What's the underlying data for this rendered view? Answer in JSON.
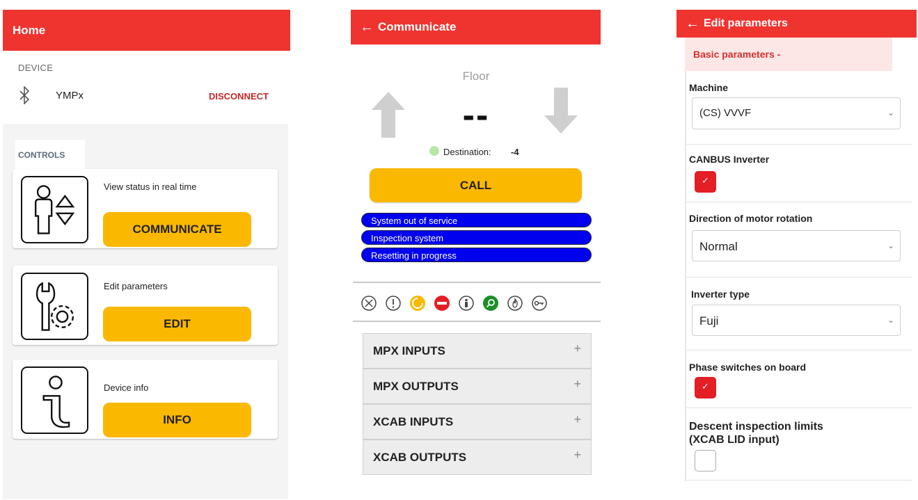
{
  "home": {
    "title": "Home",
    "device_label": "DEVICE",
    "device_name": "YMPx",
    "disconnect_label": "DISCONNECT",
    "controls_label": "CONTROLS",
    "cards": [
      {
        "text": "View status in real time",
        "button": "COMMUNICATE"
      },
      {
        "text": "Edit parameters",
        "button": "EDIT"
      },
      {
        "text": "Device info",
        "button": "INFO"
      }
    ]
  },
  "communicate": {
    "title": "Communicate",
    "floor_label": "Floor",
    "floor_value": "--",
    "destination_label": "Destination:",
    "destination_value": "-4",
    "call_label": "CALL",
    "statuses": [
      "System out of service",
      "Inspection system",
      "Resetting in progress"
    ],
    "accordions": [
      "MPX INPUTS",
      "MPX OUTPUTS",
      "XCAB INPUTS",
      "XCAB OUTPUTS"
    ],
    "plus": "+"
  },
  "edit": {
    "title": "Edit parameters",
    "section": "Basic parameters -",
    "machine_label": "Machine",
    "machine_value": "(CS) VVVF",
    "canbus_label": "CANBUS Inverter",
    "canbus_checked": true,
    "direction_label": "Direction of motor rotation",
    "direction_value": "Normal",
    "inverter_label": "Inverter type",
    "inverter_value": "Fuji",
    "phase_label": "Phase switches on board",
    "phase_checked": true,
    "descent_label_1": "Descent inspection limits",
    "descent_label_2": "(XCAB LID input)",
    "descent_checked": false
  },
  "colors": {
    "appbar": "#ef3430",
    "button": "#fbb800",
    "status_pill": "#0000ef",
    "checkbox_checked": "#e31e24"
  }
}
